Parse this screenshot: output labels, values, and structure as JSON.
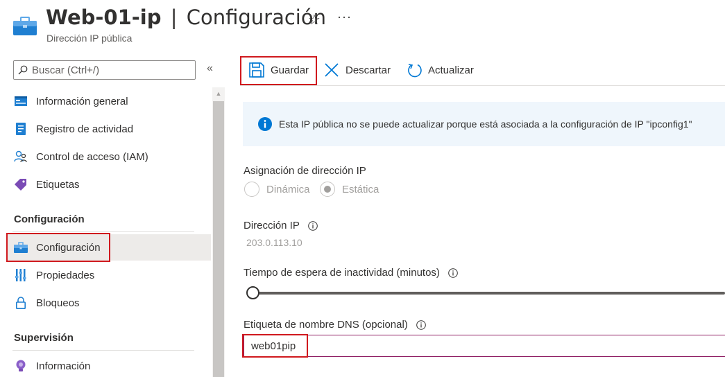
{
  "header": {
    "resource_name": "Web-01-ip",
    "separator": "|",
    "page_name": "Configuración",
    "subtitle": "Dirección IP pública",
    "star_glyph": "☆",
    "more_glyph": "···"
  },
  "sidebar": {
    "search_placeholder": "Buscar (Ctrl+/)",
    "collapse_glyph": "«",
    "items": [
      {
        "label": "Información general",
        "icon": "overview-icon"
      },
      {
        "label": "Registro de actividad",
        "icon": "activity-log-icon"
      },
      {
        "label": "Control de acceso (IAM)",
        "icon": "access-control-icon"
      },
      {
        "label": "Etiquetas",
        "icon": "tag-icon"
      }
    ],
    "section_config": "Configuración",
    "config_items": [
      {
        "label": "Configuración",
        "icon": "configuration-icon",
        "active": true
      },
      {
        "label": "Propiedades",
        "icon": "properties-icon"
      },
      {
        "label": "Bloqueos",
        "icon": "lock-icon"
      }
    ],
    "section_monitoring": "Supervisión",
    "monitoring_items": [
      {
        "label": "Información",
        "icon": "insights-icon"
      }
    ]
  },
  "toolbar": {
    "save_label": "Guardar",
    "discard_label": "Descartar",
    "refresh_label": "Actualizar"
  },
  "info_message": "Esta IP pública no se puede actualizar porque está asociada a la configuración de IP \"ipconfig1\"",
  "form": {
    "assignment_label": "Asignación de dirección IP",
    "dynamic_label": "Dinámica",
    "static_label": "Estática",
    "selected_assignment": "Estática",
    "ip_label": "Dirección IP",
    "ip_value": "203.0.113.10",
    "idle_timeout_label": "Tiempo de espera de inactividad (minutos)",
    "idle_timeout_position": 0,
    "dns_label": "Etiqueta de nombre DNS (opcional)",
    "dns_value": "web01pip"
  },
  "colors": {
    "accent": "#0078d4",
    "highlight": "#d0191e",
    "info_bg": "#eff6fc",
    "dns_border": "#8e1c63"
  }
}
